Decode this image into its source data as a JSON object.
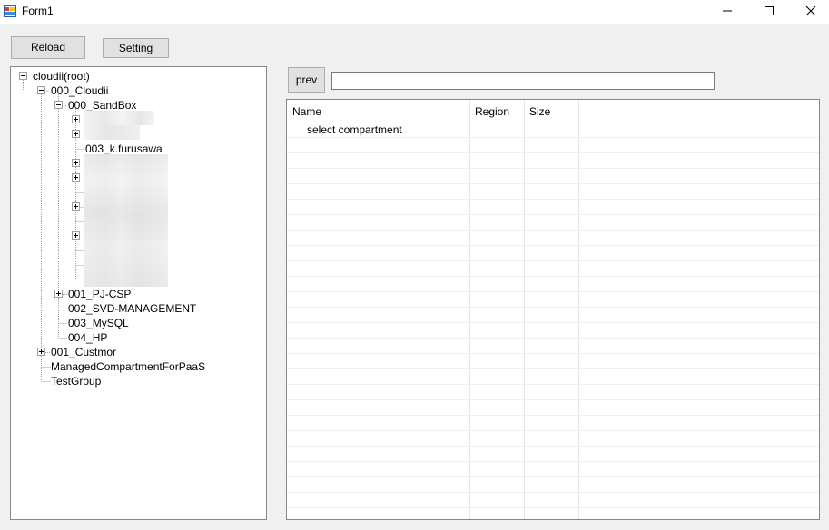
{
  "window": {
    "title": "Form1"
  },
  "toolbar": {
    "reload_label": "Reload",
    "setting_label": "Setting"
  },
  "nav": {
    "prev_label": "prev",
    "path_value": ""
  },
  "tree": {
    "root": "cloudii(root)",
    "n000_cloudii": "000_Cloudii",
    "n000_sandbox": "000_SandBox",
    "n003_k_furusawa": "003_k.furusawa",
    "n001_pj_csp": "001_PJ-CSP",
    "n002_svd_management": "002_SVD-MANAGEMENT",
    "n003_mysql": "003_MySQL",
    "n004_hp": "004_HP",
    "n001_custmor": "001_Custmor",
    "managed_compartment": "ManagedCompartmentForPaaS",
    "testgroup": "TestGroup"
  },
  "listview": {
    "columns": [
      "Name",
      "Region",
      "Size"
    ],
    "rows": [
      {
        "name": "select compartment",
        "region": "",
        "size": ""
      }
    ]
  },
  "colors": {
    "window_bg": "#f0f0f0",
    "titlebar_bg": "#ffffff",
    "button_bg": "#e1e1e1",
    "button_border": "#adadad",
    "control_border": "#828790"
  }
}
